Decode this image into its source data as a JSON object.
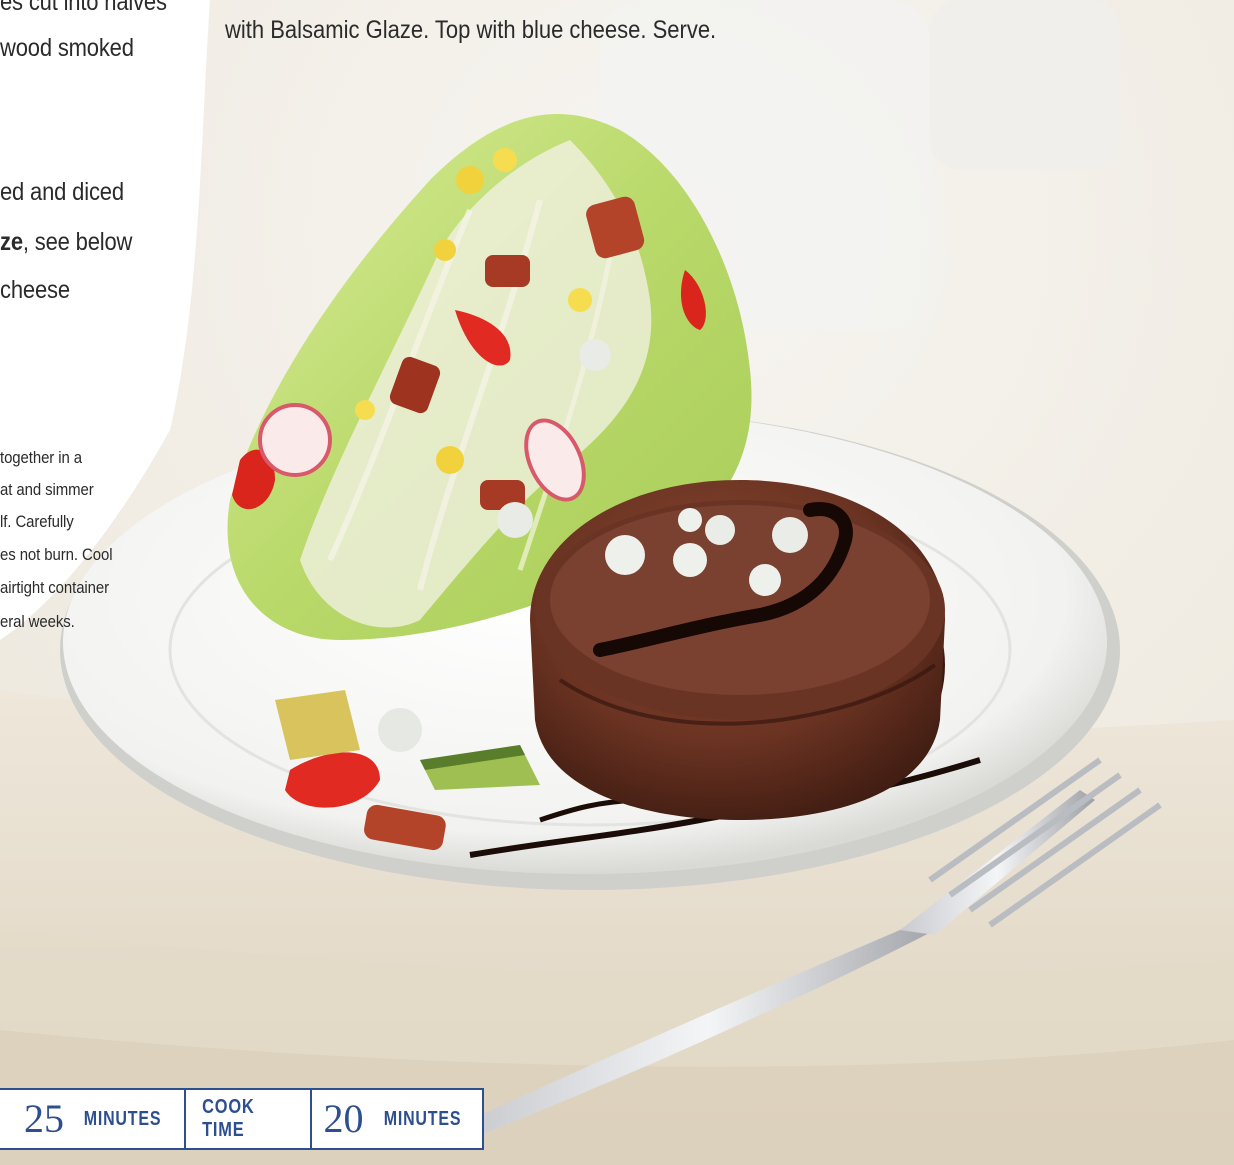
{
  "ingredients": [
    "es cut into halves",
    "wood smoked",
    "ed and diced",
    "ze, see below",
    "cheese"
  ],
  "ingredient_bold_part": "ze",
  "ingredient_rest": ", see below",
  "direction_text": "with Balsamic Glaze. Top with blue cheese. Serve.",
  "glaze_method": [
    "together in a",
    "at and simmer",
    "lf. Carefully",
    "es not burn. Cool",
    "airtight container",
    "eral weeks."
  ],
  "time_bar": {
    "prep_value": "25",
    "prep_unit": "MINUTES",
    "cook_label": "COOK TIME",
    "cook_value": "20",
    "cook_unit": "MINUTES"
  },
  "colors": {
    "accent": "#2e4f8f",
    "text": "#2b2b2b"
  }
}
